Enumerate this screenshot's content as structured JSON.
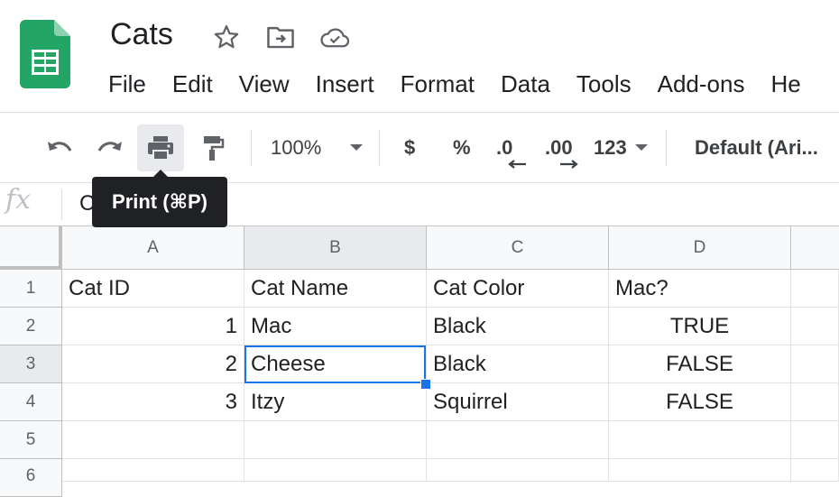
{
  "header": {
    "doc_title": "Cats",
    "icons": [
      "star-icon",
      "move-to-folder-icon",
      "cloud-saved-icon"
    ],
    "menu": [
      "File",
      "Edit",
      "View",
      "Insert",
      "Format",
      "Data",
      "Tools",
      "Add-ons",
      "He"
    ]
  },
  "toolbar": {
    "zoom": "100%",
    "currency": "$",
    "percent": "%",
    "decrease_decimal": ".0",
    "increase_decimal": ".00",
    "more_formats": "123",
    "font": "Default (Ari..."
  },
  "tooltip": {
    "text": "Print (⌘P)"
  },
  "formula_bar": {
    "fx": "fx",
    "value": "C"
  },
  "grid": {
    "columns": [
      "A",
      "B",
      "C",
      "D"
    ],
    "rows": [
      "1",
      "2",
      "3",
      "4",
      "5",
      "6"
    ],
    "cells": [
      [
        "Cat ID",
        "Cat Name",
        "Cat Color",
        "Mac?"
      ],
      [
        "1",
        "Mac",
        "Black",
        "TRUE"
      ],
      [
        "2",
        "Cheese",
        "Black",
        "FALSE"
      ],
      [
        "3",
        "Itzy",
        "Squirrel",
        "FALSE"
      ],
      [
        "",
        "",
        "",
        ""
      ],
      [
        "",
        "",
        "",
        ""
      ]
    ],
    "selected_cell": "B3"
  },
  "colors": {
    "accent": "#1a73e8",
    "sheets_green": "#0f9d58"
  }
}
